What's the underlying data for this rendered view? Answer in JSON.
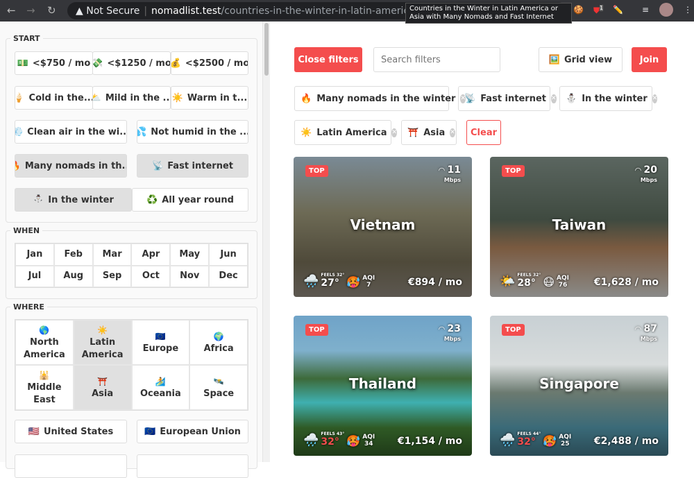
{
  "browser": {
    "security": "Not Secure",
    "host": "nomadlist.test",
    "path": "/countries-in-the-winter-in-latin-america-or-asia",
    "tooltip": "Countries in the Winter in Latin America or Asia with Many Nomads and Fast Internet",
    "ext_badge": "1"
  },
  "sidebar": {
    "start": {
      "legend": "START",
      "budget": [
        {
          "icon": "💵",
          "label": "<$750 / mo"
        },
        {
          "icon": "💸",
          "label": "<$1250 / mo"
        },
        {
          "icon": "💰",
          "label": "<$2500 / mo"
        }
      ],
      "climate": [
        {
          "icon": "🍦",
          "label": "Cold in the..."
        },
        {
          "icon": "⛅",
          "label": "Mild in the ..."
        },
        {
          "icon": "☀️",
          "label": "Warm in t..."
        }
      ],
      "air": [
        {
          "icon": "💨",
          "label": "Clean air in the wi..."
        },
        {
          "icon": "💦",
          "label": "Not humid in the ..."
        }
      ],
      "nomad": [
        {
          "icon": "🔥",
          "label": "Many nomads in th..."
        },
        {
          "icon": "📡",
          "label": "Fast internet"
        }
      ],
      "season": [
        {
          "icon": "⛄",
          "label": "In the winter"
        },
        {
          "icon": "♻️",
          "label": "All year round"
        }
      ]
    },
    "when": {
      "legend": "WHEN",
      "months": [
        "Jan",
        "Feb",
        "Mar",
        "Apr",
        "May",
        "Jun",
        "Jul",
        "Aug",
        "Sep",
        "Oct",
        "Nov",
        "Dec"
      ]
    },
    "where": {
      "legend": "WHERE",
      "regions": [
        {
          "icon": "🌎",
          "label": "North America"
        },
        {
          "icon": "☀️",
          "label": "Latin America"
        },
        {
          "icon": "🇪🇺",
          "label": "Europe"
        },
        {
          "icon": "🌍",
          "label": "Africa"
        },
        {
          "icon": "🕌",
          "label": "Middle East"
        },
        {
          "icon": "⛩️",
          "label": "Asia"
        },
        {
          "icon": "🏄",
          "label": "Oceania"
        },
        {
          "icon": "🛰️",
          "label": "Space"
        }
      ],
      "unions": [
        {
          "icon": "🇺🇸",
          "label": "United States"
        },
        {
          "icon": "🇪🇺",
          "label": "European Union"
        }
      ]
    }
  },
  "toolbar": {
    "close_filters": "Close filters",
    "search_placeholder": "Search filters",
    "grid_view_icon": "🖼️",
    "grid_view": "Grid view",
    "join": "Join",
    "clear": "Clear"
  },
  "active_filters": [
    {
      "icon": "🔥",
      "label": "Many nomads in the winter"
    },
    {
      "icon": "📡",
      "label": "Fast internet"
    },
    {
      "icon": "⛄",
      "label": "In the winter"
    },
    {
      "icon": "☀️",
      "label": "Latin America"
    },
    {
      "icon": "⛩️",
      "label": "Asia"
    }
  ],
  "cards": [
    {
      "badge": "TOP",
      "name": "Vietnam",
      "mbps": "11",
      "unit": "Mbps",
      "weather": "🌧️",
      "feels": "FEELS 32°",
      "temp": "27°",
      "aqi_icon": "🥵",
      "aqi_label": "AQI",
      "aqi": "7",
      "cost": "€894 / mo"
    },
    {
      "badge": "TOP",
      "name": "Taiwan",
      "mbps": "20",
      "unit": "Mbps",
      "weather": "🌤️",
      "feels": "FEELS 32°",
      "temp": "28°",
      "aqi_icon": "😷",
      "aqi_label": "AQI",
      "aqi": "76",
      "cost": "€1,628 / mo"
    },
    {
      "badge": "TOP",
      "name": "Thailand",
      "mbps": "23",
      "unit": "Mbps",
      "weather": "🌧️",
      "feels": "FEELS 43°",
      "temp": "32°",
      "aqi_icon": "🥵",
      "aqi_label": "AQI",
      "aqi": "34",
      "cost": "€1,154 / mo"
    },
    {
      "badge": "TOP",
      "name": "Singapore",
      "mbps": "87",
      "unit": "Mbps",
      "weather": "🌧️",
      "feels": "FEELS 44°",
      "temp": "32°",
      "aqi_icon": "🥵",
      "aqi_label": "AQI",
      "aqi": "25",
      "cost": "€2,488 / mo"
    }
  ]
}
